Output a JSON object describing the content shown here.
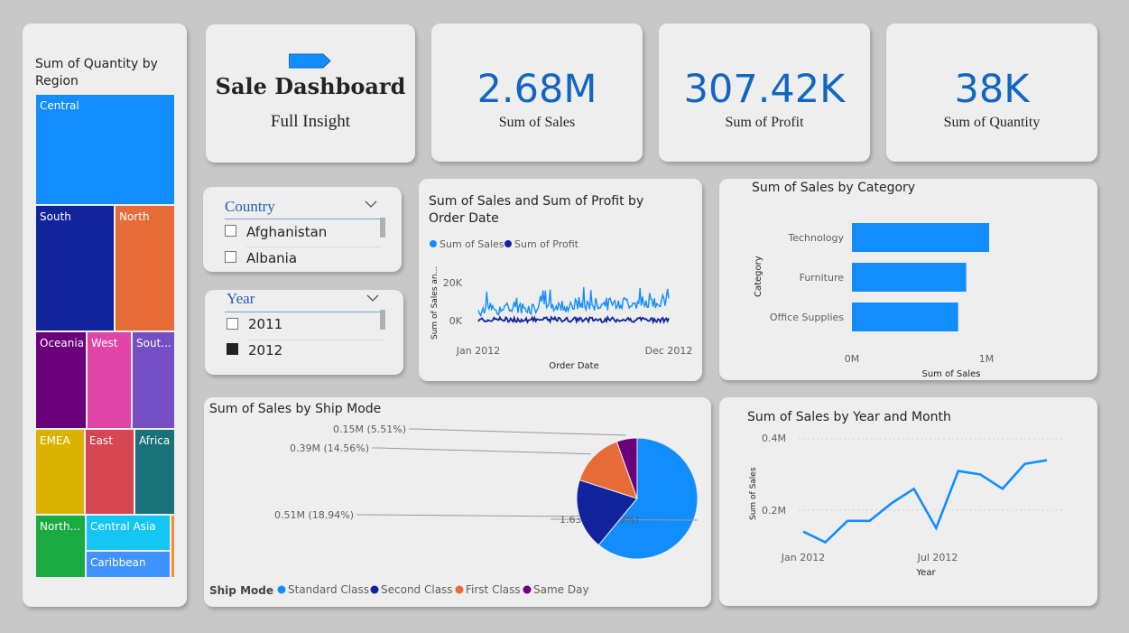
{
  "treemap": {
    "title": "Sum of Quantity by Region",
    "cells": [
      {
        "label": "Central",
        "color": "#118dff"
      },
      {
        "label": "South",
        "color": "#12239e"
      },
      {
        "label": "North",
        "color": "#e66c37"
      },
      {
        "label": "Oceania",
        "color": "#6b007b"
      },
      {
        "label": "West",
        "color": "#e044a7"
      },
      {
        "label": "Sout...",
        "color": "#744ec2"
      },
      {
        "label": "EMEA",
        "color": "#d9b300"
      },
      {
        "label": "East",
        "color": "#d64550"
      },
      {
        "label": "Africa",
        "color": "#197278"
      },
      {
        "label": "North...",
        "color": "#1aab40"
      },
      {
        "label": "Central Asia",
        "color": "#15c6f4"
      },
      {
        "label": "Caribbean",
        "color": "#4092ff"
      }
    ]
  },
  "header": {
    "title": "Sale Dashboard",
    "subtitle": "Full Insight",
    "arrow_icon": "arrow-pentagon-icon"
  },
  "kpis": [
    {
      "value": "2.68M",
      "label": "Sum of Sales"
    },
    {
      "value": "307.42K",
      "label": "Sum of Profit"
    },
    {
      "value": "38K",
      "label": "Sum of Quantity"
    }
  ],
  "slicers": {
    "country": {
      "title": "Country",
      "items": [
        {
          "label": "Afghanistan",
          "checked": false
        },
        {
          "label": "Albania",
          "checked": false
        }
      ]
    },
    "year": {
      "title": "Year",
      "items": [
        {
          "label": "2011",
          "checked": false
        },
        {
          "label": "2012",
          "checked": true
        }
      ]
    }
  },
  "colors": {
    "accent": "#118dff",
    "dark_blue": "#12239e",
    "orange": "#e66c37",
    "purple": "#6b007b",
    "kpi": "#1166c1"
  },
  "chart_data": [
    {
      "type": "line",
      "title_line1": "Sum of Sales and Sum of Profit by",
      "title_line2": "Order Date",
      "legend": [
        "Sum of Sales",
        "Sum of Profit"
      ],
      "ylabel": "Sum of Sales an...",
      "xlabel": "Order Date",
      "yticks": [
        "20K",
        "0K"
      ],
      "xticks": [
        "Jan 2012",
        "Dec 2012"
      ],
      "x_range": [
        "2012-01-01",
        "2012-12-31"
      ],
      "ylim": [
        -2000,
        30000
      ],
      "series": [
        {
          "name": "Sum of Sales",
          "approx_range": [
            0,
            29000
          ]
        },
        {
          "name": "Sum of Profit",
          "approx_range": [
            -1500,
            3000
          ]
        }
      ]
    },
    {
      "type": "bar",
      "title": "Sum of Sales by Category",
      "categories": [
        "Technology",
        "Furniture",
        "Office Supplies"
      ],
      "values": [
        1020000,
        850000,
        790000
      ],
      "xlabel": "Sum of Sales",
      "ylabel": "Category",
      "xticks": [
        "0M",
        "1M"
      ],
      "xlim": [
        0,
        1000000
      ]
    },
    {
      "type": "pie",
      "title": "Sum of Sales by Ship Mode",
      "legend_title": "Ship Mode",
      "slices": [
        {
          "name": "Standard Class",
          "value": 1.63,
          "pct": 60.99,
          "label": "1.63M (60.99%)",
          "color": "#118dff"
        },
        {
          "name": "Second Class",
          "value": 0.51,
          "pct": 18.94,
          "label": "0.51M (18.94%)",
          "color": "#12239e"
        },
        {
          "name": "First Class",
          "value": 0.39,
          "pct": 14.56,
          "label": "0.39M (14.56%)",
          "color": "#e66c37"
        },
        {
          "name": "Same Day",
          "value": 0.15,
          "pct": 5.51,
          "label": "0.15M (5.51%)",
          "color": "#6b007b"
        }
      ]
    },
    {
      "type": "line",
      "title": "Sum of Sales by Year and Month",
      "xlabel": "Year",
      "ylabel": "Sum of Sales",
      "yticks": [
        "0.4M",
        "0.2M"
      ],
      "xticks": [
        "Jan 2012",
        "Jul 2012"
      ],
      "ylim": [
        0.06,
        0.41
      ],
      "x": [
        "2012-01",
        "2012-02",
        "2012-03",
        "2012-04",
        "2012-05",
        "2012-06",
        "2012-07",
        "2012-08",
        "2012-09",
        "2012-10",
        "2012-11",
        "2012-12"
      ],
      "values": [
        0.14,
        0.11,
        0.17,
        0.17,
        0.22,
        0.26,
        0.15,
        0.31,
        0.3,
        0.26,
        0.33,
        0.34
      ]
    }
  ]
}
